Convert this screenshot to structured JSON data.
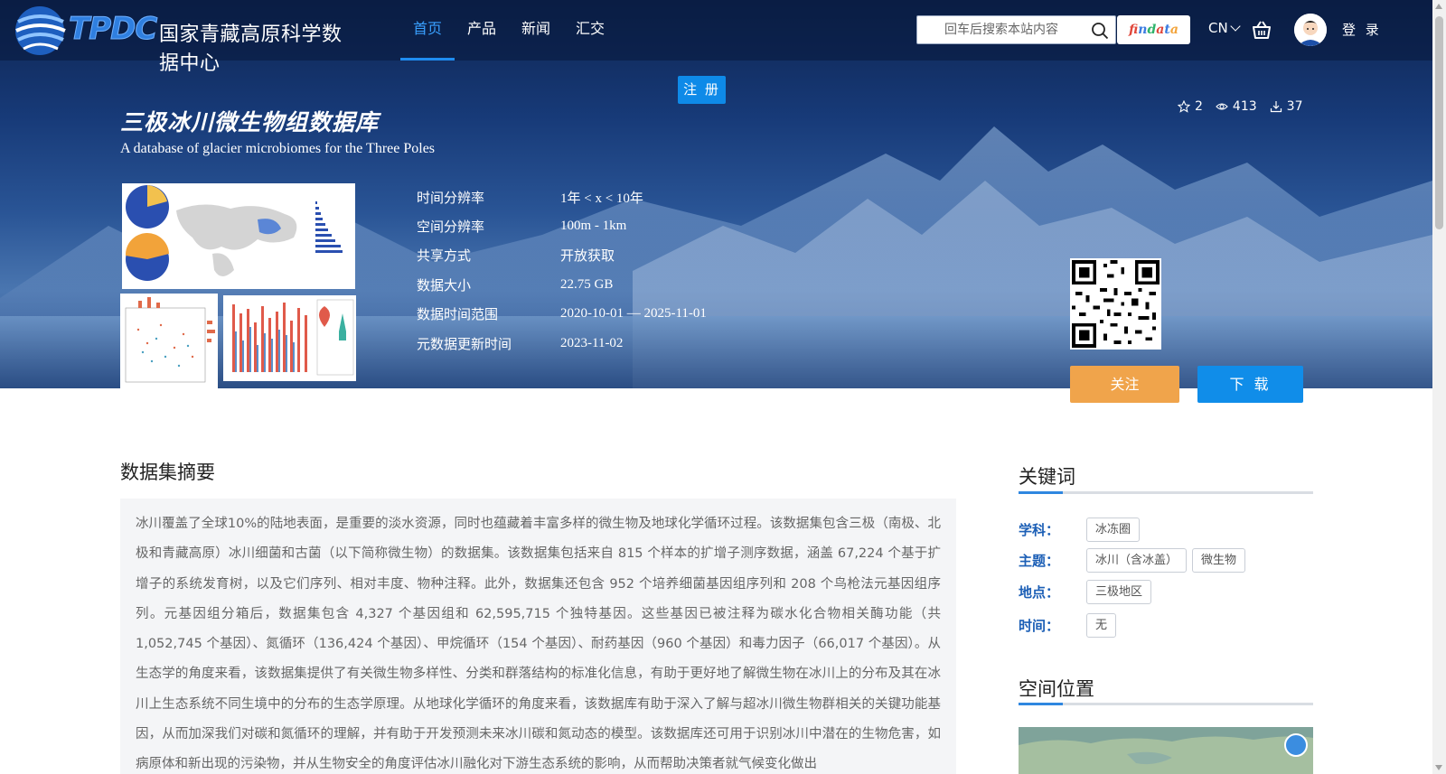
{
  "nav": {
    "logo_text": "TPDC",
    "site_name": "国家青藏高原科学数据中心",
    "menu": [
      {
        "label": "首页",
        "active": true
      },
      {
        "label": "产品",
        "active": false
      },
      {
        "label": "新闻",
        "active": false
      },
      {
        "label": "汇交",
        "active": false
      }
    ],
    "search_placeholder": "回车后搜索本站内容",
    "findata_label": "findata",
    "lang": "CN",
    "login": "登 录",
    "icons": [
      "search-icon",
      "cart-icon",
      "avatar-icon",
      "chevron-down-icon"
    ]
  },
  "hero": {
    "register_label": "注 册",
    "title": "三极冰川微生物组数据库",
    "subtitle": "A database of glacier microbiomes for the Three Poles",
    "stats": {
      "stars": "2",
      "views": "413",
      "downloads": "37"
    },
    "meta": [
      {
        "label": "时间分辨率",
        "value": "1年 < x < 10年"
      },
      {
        "label": "空间分辨率",
        "value": "100m - 1km"
      },
      {
        "label": "共享方式",
        "value": "开放获取"
      },
      {
        "label": "数据大小",
        "value": "22.75 GB"
      },
      {
        "label": "数据时间范围",
        "value": "2020-10-01 — 2025-11-01"
      },
      {
        "label": "元数据更新时间",
        "value": "2023-11-02"
      }
    ],
    "follow_label": "关注",
    "download_label": "下 载"
  },
  "abstract": {
    "title": "数据集摘要",
    "text": "冰川覆盖了全球10%的陆地表面，是重要的淡水资源，同时也蕴藏着丰富多样的微生物及地球化学循环过程。该数据集包含三极（南极、北极和青藏高原）冰川细菌和古菌（以下简称微生物）的数据集。该数据集包括来自 815 个样本的扩增子测序数据，涵盖 67,224 个基于扩增子的系统发育树，以及它们序列、相对丰度、物种注释。此外，数据集还包含 952 个培养细菌基因组序列和 208 个鸟枪法元基因组序列。元基因组分箱后，数据集包含 4,327 个基因组和 62,595,715 个独特基因。这些基因已被注释为碳水化合物相关酶功能（共 1,052,745 个基因）、氮循环（136,424 个基因）、甲烷循环（154 个基因）、耐药基因（960 个基因）和毒力因子（66,017 个基因）。从生态学的角度来看，该数据集提供了有关微生物多样性、分类和群落结构的标准化信息，有助于更好地了解微生物在冰川上的分布及其在冰川上生态系统不同生境中的分布的生态学原理。从地球化学循环的角度来看，该数据库有助于深入了解与超冰川微生物群相关的关键功能基因，从而加深我们对碳和氮循环的理解，并有助于开发预测未来冰川碳和氮动态的模型。该数据库还可用于识别冰川中潜在的生物危害，如病原体和新出现的污染物，并从生物安全的角度评估冰川融化对下游生态系统的影响，从而帮助决策者就气候变化做出"
  },
  "keywords": {
    "title": "关键词",
    "rows": [
      {
        "label": "学科：",
        "tags": [
          "冰冻圈"
        ]
      },
      {
        "label": "主题：",
        "tags": [
          "冰川（含冰盖）",
          "微生物"
        ]
      },
      {
        "label": "地点：",
        "tags": [
          "三极地区"
        ]
      },
      {
        "label": "时间：",
        "tags": [
          "无"
        ]
      }
    ]
  },
  "location": {
    "title": "空间位置"
  },
  "colors": {
    "accent": "#1f8cf0",
    "follow": "#f0a44b",
    "download": "#108de9",
    "keyword_label": "#1c5fb6"
  }
}
